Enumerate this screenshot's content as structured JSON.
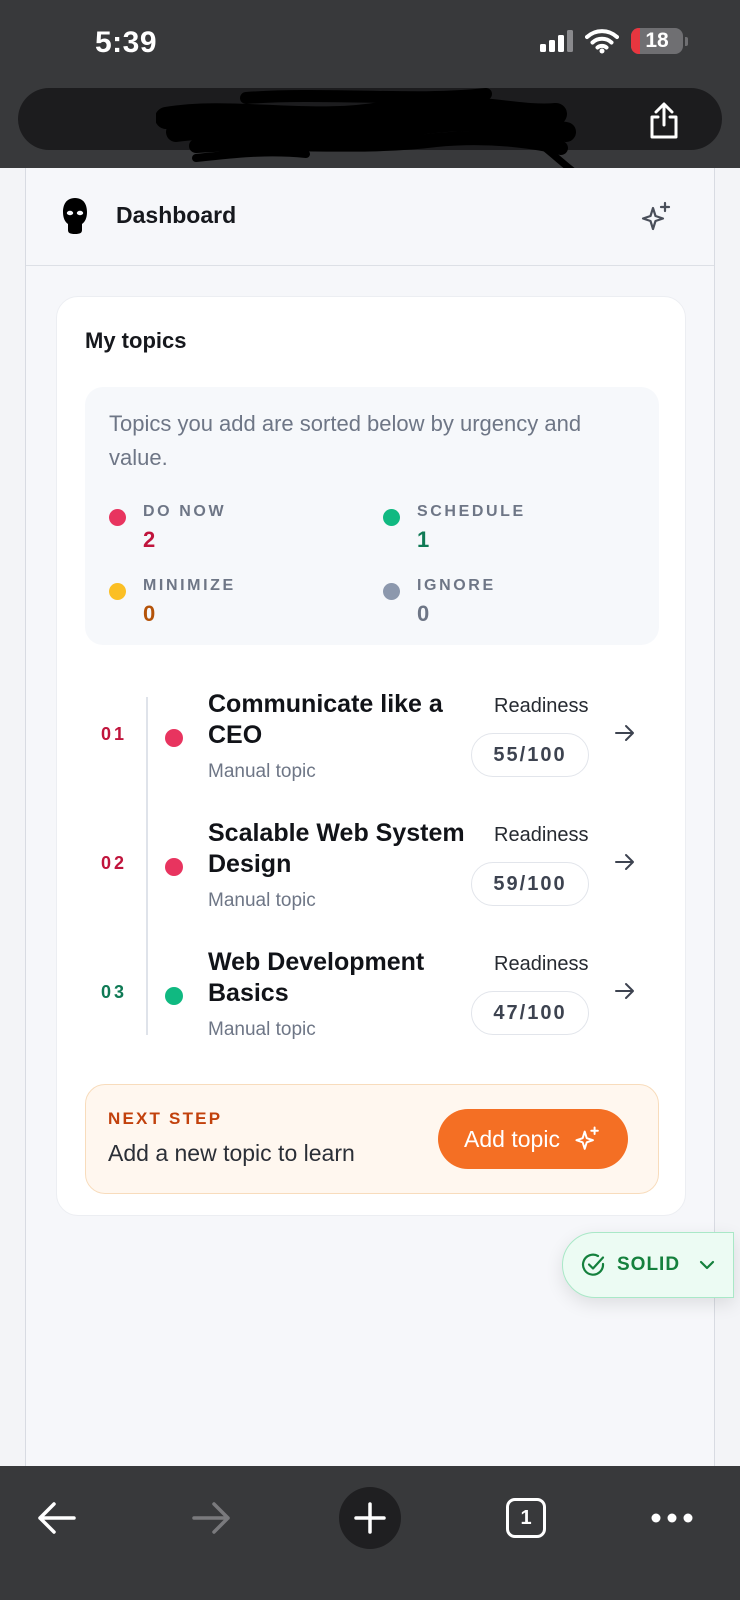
{
  "status_bar": {
    "time": "5:39",
    "battery": "18",
    "battery_level": 0.18
  },
  "header": {
    "title": "Dashboard"
  },
  "topics_card": {
    "title": "My topics",
    "description": "Topics you add are sorted below by urgency and value.",
    "quadrants": [
      {
        "label": "DO NOW",
        "count": "2",
        "color": "#e8345f"
      },
      {
        "label": "SCHEDULE",
        "count": "1",
        "color": "#10b981"
      },
      {
        "label": "MINIMIZE",
        "count": "0",
        "color": "#fbbf24"
      },
      {
        "label": "IGNORE",
        "count": "0",
        "color": "#8c98ad"
      }
    ],
    "topics": [
      {
        "num": "01",
        "title": "Communicate like a CEO",
        "subtitle": "Manual topic",
        "readiness_label": "Readiness",
        "score": "55/100",
        "color": "#e8345f",
        "num_color": "#c0143c"
      },
      {
        "num": "02",
        "title": "Scalable Web System Design",
        "subtitle": "Manual topic",
        "readiness_label": "Readiness",
        "score": "59/100",
        "color": "#e8345f",
        "num_color": "#c0143c"
      },
      {
        "num": "03",
        "title": "Web Development Basics",
        "subtitle": "Manual topic",
        "readiness_label": "Readiness",
        "score": "47/100",
        "color": "#10b981",
        "num_color": "#0f7a55"
      }
    ]
  },
  "next_step": {
    "label": "NEXT STEP",
    "text": "Add a new topic to learn",
    "button_label": "Add topic"
  },
  "solid_badge": {
    "label": "SOLID"
  },
  "browser_toolbar": {
    "tab_count": "1"
  },
  "icons": [
    "signal-icon",
    "wifi-icon",
    "battery-icon",
    "share-icon",
    "avatar-icon",
    "sparkle-icon",
    "arrow-right-icon",
    "check-circle-icon",
    "chevron-down-icon",
    "back-arrow-icon",
    "forward-arrow-icon",
    "plus-icon",
    "tabs-icon",
    "more-icon"
  ],
  "colors": {
    "accent": "#f46f24",
    "do_now": "#e8345f",
    "schedule": "#10b981",
    "minimize": "#fbbf24",
    "ignore": "#8c98ad"
  }
}
